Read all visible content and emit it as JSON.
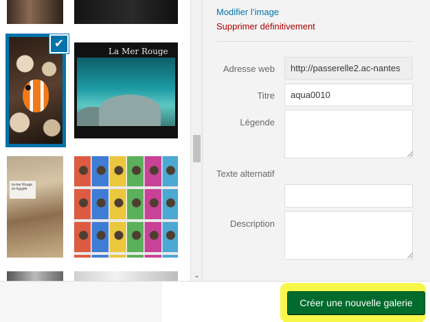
{
  "gallery": {
    "thumbnails": [
      {
        "name": "thumb-top-left"
      },
      {
        "name": "thumb-top-right"
      },
      {
        "name": "thumb-clownfish",
        "selected": true
      },
      {
        "name": "thumb-aquarium",
        "sign_text": "La Mer Rouge"
      },
      {
        "name": "thumb-poster",
        "note_text": "la mer Rouge en Egypte"
      },
      {
        "name": "thumb-art-wall"
      },
      {
        "name": "thumb-bottom-left"
      },
      {
        "name": "thumb-bottom-right"
      }
    ],
    "check_glyph": "✔"
  },
  "details": {
    "edit_link": "Modifier l’image",
    "delete_link": "Supprimer définitivement",
    "url_label": "Adresse web",
    "url_value": "http://passerelle2.ac-nantes",
    "title_label": "Titre",
    "title_value": "aqua0010",
    "caption_label": "Légende",
    "alt_label": "Texte alternatif",
    "description_label": "Description"
  },
  "toolbar": {
    "create_gallery_label": "Créer une nouvelle galerie"
  },
  "colors": {
    "accent": "#0073aa",
    "danger": "#a00000",
    "primary_button": "#006b2c",
    "highlight": "#f7f74a"
  }
}
